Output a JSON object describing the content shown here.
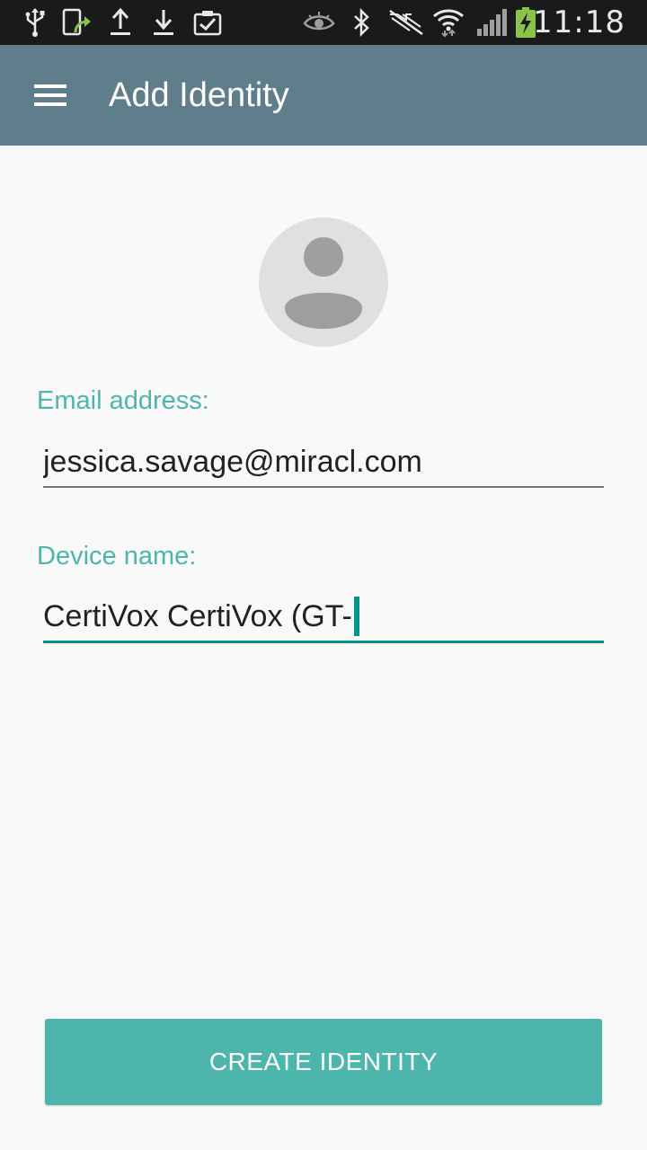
{
  "status_bar": {
    "time": "11:18",
    "left_icons": [
      "usb-icon",
      "screen-share-icon",
      "upload-icon",
      "download-icon",
      "clipboard-check-icon"
    ],
    "right_icons": [
      "eye-icon",
      "bluetooth-icon",
      "mute-icon",
      "wifi-icon",
      "signal-icon",
      "battery-charging-icon"
    ],
    "background_color": "#1a1a1a"
  },
  "toolbar": {
    "title": "Add Identity",
    "menu_icon": "hamburger-menu-icon",
    "background_color": "#607d8b"
  },
  "avatar": {
    "icon": "default-user-avatar-icon"
  },
  "form": {
    "email": {
      "label": "Email address:",
      "value": "jessica.savage@miracl.com",
      "placeholder": ""
    },
    "device": {
      "label": "Device name:",
      "value": "CertiVox CertiVox (GT-",
      "placeholder": "",
      "focused": true
    }
  },
  "actions": {
    "create_label": "CREATE IDENTITY"
  },
  "colors": {
    "accent": "#009688",
    "label": "#4db6ac",
    "button": "#4db6ac",
    "background": "#f9f9f9"
  }
}
